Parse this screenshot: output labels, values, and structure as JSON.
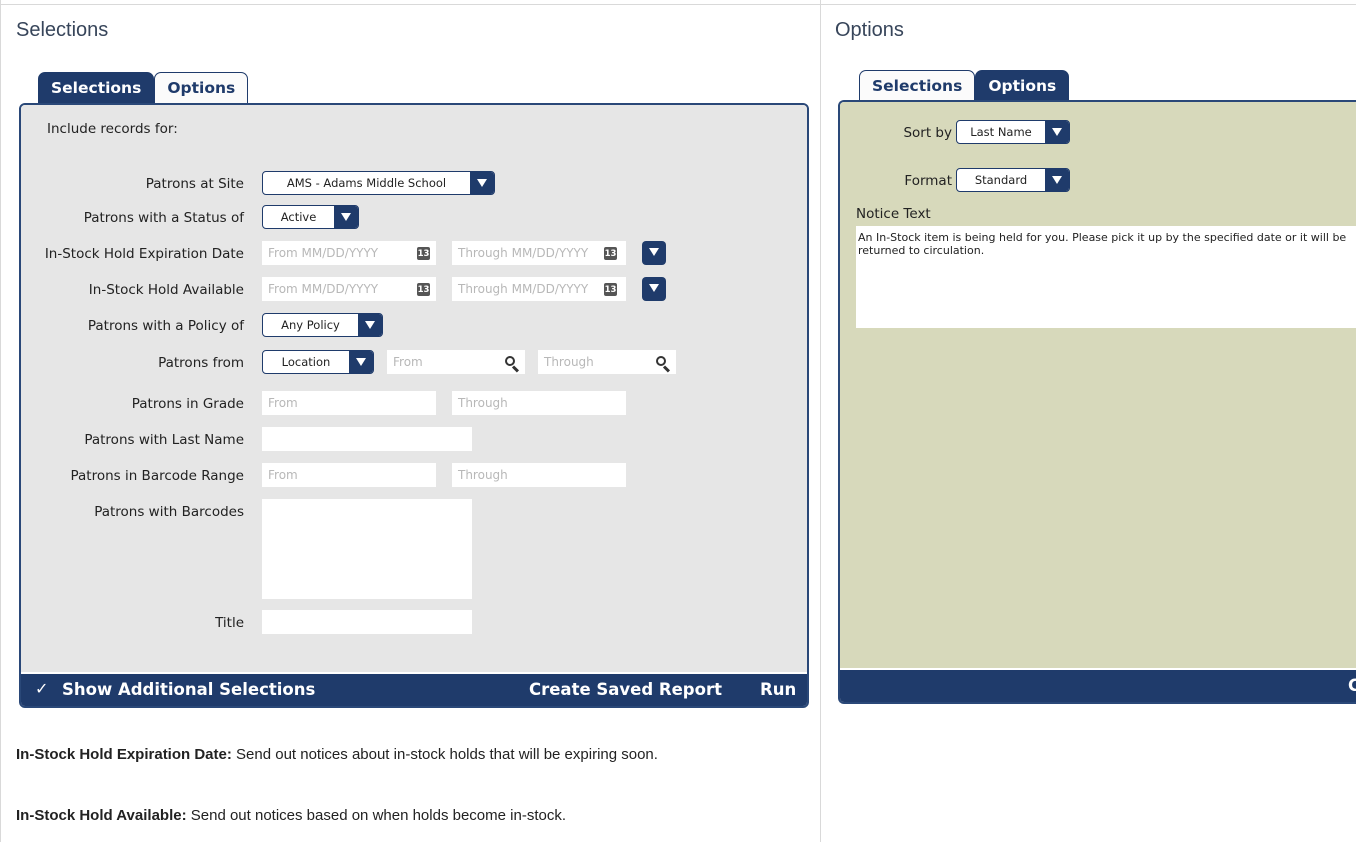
{
  "left": {
    "title": "Selections",
    "tabs": [
      {
        "label": "Selections",
        "active": true
      },
      {
        "label": "Options",
        "active": false
      }
    ],
    "include_label": "Include records for:",
    "rows": {
      "site": {
        "label": "Patrons at Site",
        "value": "AMS - Adams Middle School"
      },
      "status": {
        "label": "Patrons with a Status of",
        "value": "Active"
      },
      "expiration": {
        "label": "In-Stock Hold Expiration Date",
        "from_placeholder": "From MM/DD/YYYY",
        "through_placeholder": "Through MM/DD/YYYY"
      },
      "available": {
        "label": "In-Stock Hold Available",
        "from_placeholder": "From MM/DD/YYYY",
        "through_placeholder": "Through MM/DD/YYYY"
      },
      "policy": {
        "label": "Patrons with a Policy of",
        "value": "Any Policy"
      },
      "from": {
        "label": "Patrons from",
        "value": "Location",
        "from_placeholder": "From",
        "through_placeholder": "Through"
      },
      "grade": {
        "label": "Patrons in Grade",
        "from_placeholder": "From",
        "through_placeholder": "Through"
      },
      "last_name": {
        "label": "Patrons with Last Name",
        "value": ""
      },
      "barcode_range": {
        "label": "Patrons in Barcode Range",
        "from_placeholder": "From",
        "through_placeholder": "Through"
      },
      "barcodes": {
        "label": "Patrons with Barcodes",
        "value": ""
      },
      "title": {
        "label": "Title",
        "value": ""
      }
    },
    "calendar_glyph": "13",
    "footer": {
      "checkbox_mark": "✓",
      "show_additional": "Show Additional Selections",
      "create_saved": "Create Saved Report",
      "run": "Run"
    }
  },
  "right": {
    "title": "Options",
    "tabs": [
      {
        "label": "Selections",
        "active": false
      },
      {
        "label": "Options",
        "active": true
      }
    ],
    "sort_by": {
      "label": "Sort by",
      "value": "Last Name"
    },
    "format": {
      "label": "Format",
      "value": "Standard"
    },
    "notice_label": "Notice Text",
    "notice_text": "An In-Stock item is being held for you. Please pick it up by the specified date or it will be returned to circulation.",
    "footer_fragment": "C"
  },
  "descriptions": [
    {
      "term": "In-Stock Hold Expiration Date:",
      "text": " Send out notices about in-stock holds that will be expiring soon."
    },
    {
      "term": "In-Stock Hold Available:",
      "text": " Send out notices based on when holds become in-stock."
    }
  ],
  "colors": {
    "navy": "#1f3b6b",
    "panel_gray": "#e6e6e6",
    "panel_green": "#d7d9bb"
  }
}
